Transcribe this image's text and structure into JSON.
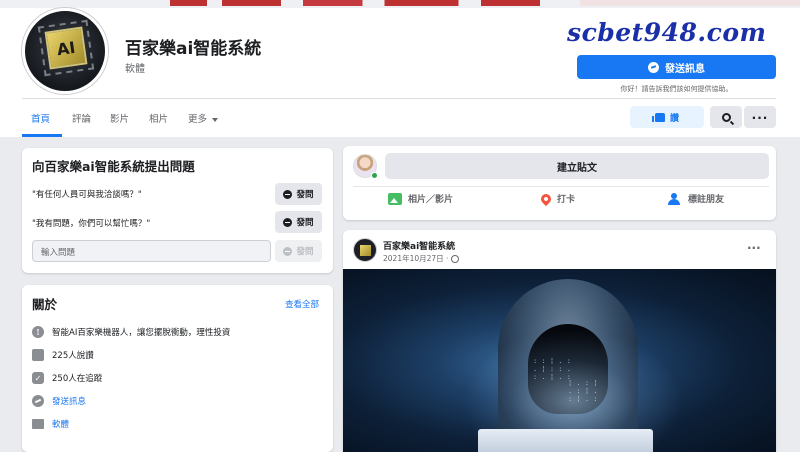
{
  "page": {
    "name": "百家樂ai智能系統",
    "category": "軟體",
    "avatar_text": "AI",
    "watermark": "scbet948.com"
  },
  "actions": {
    "send_message": "發送訊息",
    "send_message_hint": "你好！請告訴我們該如何提供協助。",
    "like": "讚"
  },
  "tabs": [
    {
      "label": "首頁",
      "active": true
    },
    {
      "label": "評論",
      "active": false
    },
    {
      "label": "影片",
      "active": false
    },
    {
      "label": "相片",
      "active": false
    },
    {
      "label": "更多",
      "active": false
    }
  ],
  "questions": {
    "title": "向百家樂ai智能系統提出問題",
    "items": [
      {
        "text": "\"有任何人員可與我洽談嗎？\"",
        "button": "發問"
      },
      {
        "text": "\"我有問題，你們可以幫忙嗎？\"",
        "button": "發問"
      }
    ],
    "input_placeholder": "輸入問題",
    "submit_button": "發問"
  },
  "about": {
    "title": "關於",
    "see_all": "查看全部",
    "rows": [
      {
        "icon": "info-icon",
        "text": "智能AI百家樂機器人，讓您擺脫衝動，理性投資"
      },
      {
        "icon": "like-icon",
        "text": "225人說讚"
      },
      {
        "icon": "follow-icon",
        "text": "250人在追蹤"
      },
      {
        "icon": "messenger-icon",
        "text": "發送訊息",
        "link": true
      },
      {
        "icon": "category-icon",
        "text": "軟體",
        "link": true
      }
    ]
  },
  "composer": {
    "create_post": "建立貼文",
    "photo_video": "相片／影片",
    "check_in": "打卡",
    "tag_friends": "標註朋友"
  },
  "post": {
    "author": "百家樂ai智能系統",
    "date": "2021年10月27日 ·",
    "more": "···"
  },
  "colors": {
    "accent": "#1877f2",
    "watermark": "#1a2fa8",
    "online": "#31a24c",
    "photo": "#45bd62",
    "checkin": "#f5533d"
  }
}
